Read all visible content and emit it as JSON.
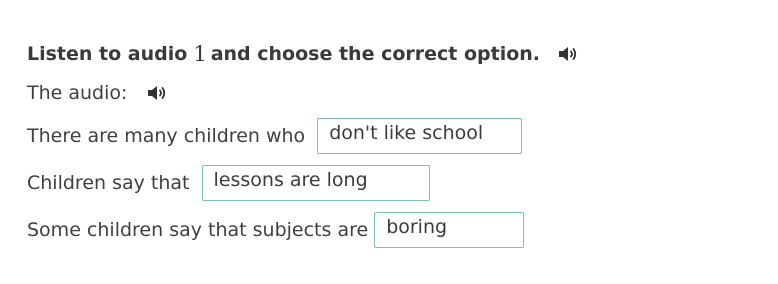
{
  "task": {
    "instruction_prefix": "Listen to audio",
    "audio_number": "1",
    "instruction_suffix": "and choose the correct option.",
    "audio_label": "The audio:"
  },
  "icons": {
    "speaker": "speaker-icon"
  },
  "colors": {
    "answer_border": "#7cc4a8",
    "text": "#3f3f3f"
  },
  "sentences": [
    {
      "prefix": "There are many children who",
      "answer": "don't like school"
    },
    {
      "prefix": "Children say that",
      "answer": "lessons are long"
    },
    {
      "prefix": "Some children say that subjects are",
      "answer": "boring"
    }
  ]
}
